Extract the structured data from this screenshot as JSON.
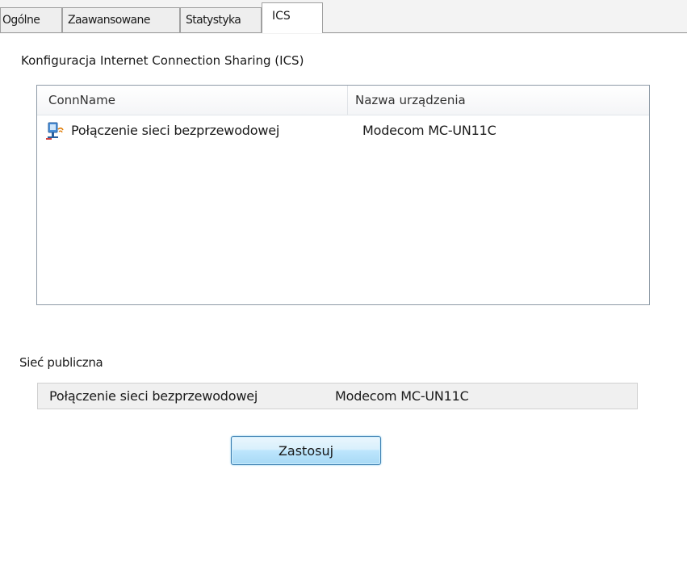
{
  "tabs": [
    {
      "label": "Ogólne"
    },
    {
      "label": "Zaawansowane"
    },
    {
      "label": "Statystyka"
    },
    {
      "label": "ICS",
      "active": true
    }
  ],
  "ics": {
    "section_title": "Konfiguracja Internet Connection Sharing (ICS)",
    "columns": [
      "ConnName",
      "Nazwa urządzenia"
    ],
    "rows": [
      {
        "icon": "network-connection-icon",
        "conn_name": "Połączenie sieci bezprzewodowej",
        "device": "Modecom MC-UN11C"
      }
    ]
  },
  "public_network": {
    "label": "Sieć publiczna",
    "conn_name": "Połączenie sieci bezprzewodowej",
    "device": "Modecom MC-UN11C"
  },
  "apply_button": {
    "label": "Zastosuj"
  },
  "colors": {
    "button_border": "#3c7fb1",
    "button_fill": "#bee6fd",
    "tab_border": "#a0a0a0"
  }
}
